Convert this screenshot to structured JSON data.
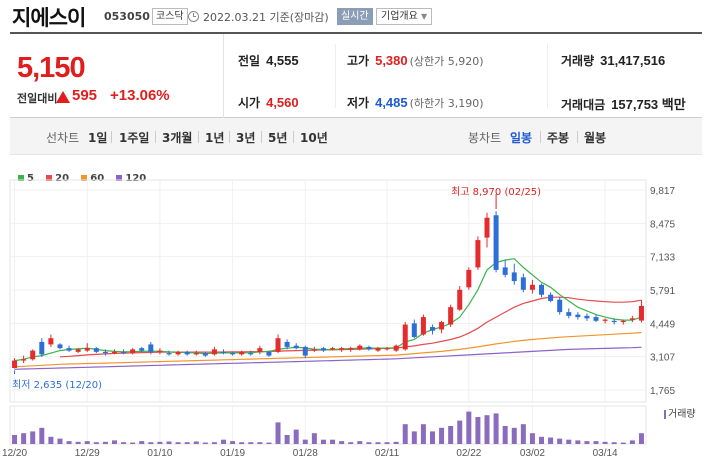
{
  "header": {
    "name": "지에스이",
    "code": "053050",
    "market": "코스닥",
    "date": "2022.03.21 기준(장마감)",
    "realtime": "실시간",
    "overview": "기업개요"
  },
  "quote": {
    "price": "5,150",
    "change_label": "전일대비",
    "change_amount": "595",
    "change_pct": "+13.06%",
    "prev_close_label": "전일",
    "prev_close": "4,555",
    "high_label": "고가",
    "high": "5,380",
    "upper_limit": "(상한가 5,920)",
    "volume_label": "거래량",
    "volume": "31,417,516",
    "open_label": "시가",
    "open": "4,560",
    "low_label": "저가",
    "low": "4,485",
    "lower_limit": "(하한가 3,190)",
    "amount_label": "거래대금",
    "amount": "157,753 백만"
  },
  "period_bar": {
    "line_label": "선차트",
    "line_items": [
      "1일",
      "1주일",
      "3개월",
      "1년",
      "3년",
      "5년",
      "10년"
    ],
    "candle_label": "봉차트",
    "candle_items": [
      "일봉",
      "주봉",
      "월봉"
    ],
    "active_candle": "일봉"
  },
  "legend": [
    {
      "label": "5",
      "color": "#3cb44b"
    },
    {
      "label": "20",
      "color": "#e64b4b"
    },
    {
      "label": "60",
      "color": "#f0962d"
    },
    {
      "label": "120",
      "color": "#8c64c8"
    }
  ],
  "volume_label": "거래량",
  "chart_data": {
    "type": "candlestick",
    "y_ticks": [
      "9,817",
      "8,475",
      "7,133",
      "5,791",
      "4,449",
      "3,107",
      "1,765"
    ],
    "y_values": [
      9817,
      8475,
      7133,
      5791,
      4449,
      3107,
      1765
    ],
    "x_labels": [
      "12/20",
      "12/29",
      "01/10",
      "01/19",
      "01/28",
      "02/11",
      "02/22",
      "03/02",
      "03/14"
    ],
    "max_label": "최고 8,970 (02/25)",
    "min_label": "최저 2,635 (12/20)",
    "candles": [
      {
        "o": 2650,
        "h": 3050,
        "l": 2635,
        "c": 2950
      },
      {
        "o": 2950,
        "h": 3150,
        "l": 2850,
        "c": 3000
      },
      {
        "o": 3000,
        "h": 3400,
        "l": 2950,
        "c": 3350
      },
      {
        "o": 3700,
        "h": 3850,
        "l": 3100,
        "c": 3200
      },
      {
        "o": 3600,
        "h": 4000,
        "l": 3500,
        "c": 3850
      },
      {
        "o": 3600,
        "h": 3650,
        "l": 3400,
        "c": 3450
      },
      {
        "o": 3450,
        "h": 3550,
        "l": 3300,
        "c": 3350
      },
      {
        "o": 3300,
        "h": 3450,
        "l": 3250,
        "c": 3400
      },
      {
        "o": 3350,
        "h": 3650,
        "l": 3300,
        "c": 3450
      },
      {
        "o": 3450,
        "h": 3500,
        "l": 3250,
        "c": 3300
      },
      {
        "o": 3300,
        "h": 3400,
        "l": 3150,
        "c": 3250
      },
      {
        "o": 3250,
        "h": 3400,
        "l": 3200,
        "c": 3300
      },
      {
        "o": 3300,
        "h": 3400,
        "l": 3200,
        "c": 3250
      },
      {
        "o": 3250,
        "h": 3450,
        "l": 3200,
        "c": 3400
      },
      {
        "o": 3450,
        "h": 3500,
        "l": 3300,
        "c": 3350
      },
      {
        "o": 3600,
        "h": 3700,
        "l": 3200,
        "c": 3300
      },
      {
        "o": 3300,
        "h": 3450,
        "l": 3200,
        "c": 3350
      },
      {
        "o": 3250,
        "h": 3350,
        "l": 3150,
        "c": 3200
      },
      {
        "o": 3200,
        "h": 3350,
        "l": 3150,
        "c": 3300
      },
      {
        "o": 3300,
        "h": 3350,
        "l": 3150,
        "c": 3200
      },
      {
        "o": 3200,
        "h": 3350,
        "l": 3150,
        "c": 3250
      },
      {
        "o": 3250,
        "h": 3300,
        "l": 3100,
        "c": 3150
      },
      {
        "o": 3200,
        "h": 3500,
        "l": 3150,
        "c": 3400
      },
      {
        "o": 3300,
        "h": 3400,
        "l": 3200,
        "c": 3250
      },
      {
        "o": 3250,
        "h": 3300,
        "l": 3150,
        "c": 3200
      },
      {
        "o": 3200,
        "h": 3350,
        "l": 3150,
        "c": 3300
      },
      {
        "o": 3250,
        "h": 3350,
        "l": 3150,
        "c": 3200
      },
      {
        "o": 3300,
        "h": 3550,
        "l": 3200,
        "c": 3450
      },
      {
        "o": 3300,
        "h": 3350,
        "l": 3100,
        "c": 3150
      },
      {
        "o": 3300,
        "h": 4000,
        "l": 3250,
        "c": 3850
      },
      {
        "o": 3700,
        "h": 3800,
        "l": 3400,
        "c": 3500
      },
      {
        "o": 3550,
        "h": 3650,
        "l": 3400,
        "c": 3450
      },
      {
        "o": 3500,
        "h": 3550,
        "l": 3050,
        "c": 3150
      },
      {
        "o": 3350,
        "h": 3500,
        "l": 3300,
        "c": 3400
      },
      {
        "o": 3450,
        "h": 3500,
        "l": 3300,
        "c": 3350
      },
      {
        "o": 3400,
        "h": 3500,
        "l": 3350,
        "c": 3450
      },
      {
        "o": 3400,
        "h": 3500,
        "l": 3300,
        "c": 3450
      },
      {
        "o": 3400,
        "h": 3500,
        "l": 3300,
        "c": 3450
      },
      {
        "o": 3400,
        "h": 3600,
        "l": 3350,
        "c": 3550
      },
      {
        "o": 3500,
        "h": 3550,
        "l": 3350,
        "c": 3400
      },
      {
        "o": 3350,
        "h": 3500,
        "l": 3300,
        "c": 3450
      },
      {
        "o": 3400,
        "h": 3500,
        "l": 3350,
        "c": 3450
      },
      {
        "o": 3350,
        "h": 3600,
        "l": 3300,
        "c": 3550
      },
      {
        "o": 3400,
        "h": 4500,
        "l": 3350,
        "c": 4400
      },
      {
        "o": 4450,
        "h": 4600,
        "l": 3850,
        "c": 3900
      },
      {
        "o": 4000,
        "h": 4800,
        "l": 3950,
        "c": 4700
      },
      {
        "o": 4300,
        "h": 4400,
        "l": 4000,
        "c": 4150
      },
      {
        "o": 4200,
        "h": 4550,
        "l": 4050,
        "c": 4500
      },
      {
        "o": 4400,
        "h": 5200,
        "l": 4300,
        "c": 5100
      },
      {
        "o": 5000,
        "h": 5950,
        "l": 4950,
        "c": 5800
      },
      {
        "o": 5900,
        "h": 6700,
        "l": 5800,
        "c": 6600
      },
      {
        "o": 6700,
        "h": 7950,
        "l": 6600,
        "c": 7800
      },
      {
        "o": 7900,
        "h": 8900,
        "l": 7500,
        "c": 8700
      },
      {
        "o": 8800,
        "h": 8970,
        "l": 6500,
        "c": 6600
      },
      {
        "o": 6700,
        "h": 7000,
        "l": 6300,
        "c": 6400
      },
      {
        "o": 6500,
        "h": 6850,
        "l": 6000,
        "c": 6150
      },
      {
        "o": 6300,
        "h": 6450,
        "l": 5700,
        "c": 5800
      },
      {
        "o": 5800,
        "h": 6200,
        "l": 5650,
        "c": 6000
      },
      {
        "o": 6000,
        "h": 6050,
        "l": 5500,
        "c": 5600
      },
      {
        "o": 5600,
        "h": 5700,
        "l": 5300,
        "c": 5350
      },
      {
        "o": 5400,
        "h": 5500,
        "l": 4800,
        "c": 4900
      },
      {
        "o": 4900,
        "h": 5050,
        "l": 4650,
        "c": 4750
      },
      {
        "o": 4800,
        "h": 4900,
        "l": 4600,
        "c": 4700
      },
      {
        "o": 4750,
        "h": 4850,
        "l": 4550,
        "c": 4650
      },
      {
        "o": 4700,
        "h": 4800,
        "l": 4500,
        "c": 4550
      },
      {
        "o": 4550,
        "h": 4650,
        "l": 4450,
        "c": 4600
      },
      {
        "o": 4550,
        "h": 4650,
        "l": 4400,
        "c": 4500
      },
      {
        "o": 4500,
        "h": 4600,
        "l": 4400,
        "c": 4550
      },
      {
        "o": 4600,
        "h": 4750,
        "l": 4500,
        "c": 4650
      },
      {
        "o": 4560,
        "h": 5380,
        "l": 4485,
        "c": 5150
      }
    ],
    "ma5": [
      2950,
      3000,
      3100,
      3150,
      3250,
      3350,
      3400,
      3420,
      3450,
      3400,
      3350,
      3320,
      3300,
      3310,
      3320,
      3330,
      3320,
      3300,
      3290,
      3270,
      3260,
      3230,
      3250,
      3260,
      3260,
      3260,
      3270,
      3300,
      3320,
      3400,
      3450,
      3480,
      3460,
      3400,
      3400,
      3390,
      3420,
      3430,
      3450,
      3450,
      3450,
      3450,
      3460,
      3700,
      3800,
      4050,
      4200,
      4300,
      4450,
      4700,
      5200,
      5800,
      6600,
      6900,
      7000,
      7050,
      6700,
      6400,
      6100,
      5900,
      5600,
      5350,
      5100,
      4950,
      4800,
      4700,
      4620,
      4580,
      4580,
      4700
    ],
    "ma20": [
      null,
      null,
      null,
      null,
      null,
      3100,
      3120,
      3150,
      3180,
      3200,
      3220,
      3240,
      3250,
      3260,
      3270,
      3280,
      3285,
      3290,
      3290,
      3290,
      3290,
      3290,
      3290,
      3295,
      3300,
      3300,
      3305,
      3310,
      3315,
      3330,
      3340,
      3350,
      3360,
      3370,
      3380,
      3385,
      3390,
      3400,
      3410,
      3420,
      3430,
      3440,
      3450,
      3500,
      3540,
      3600,
      3650,
      3720,
      3800,
      3900,
      4050,
      4250,
      4500,
      4700,
      4900,
      5100,
      5250,
      5350,
      5450,
      5500,
      5500,
      5480,
      5420,
      5380,
      5350,
      5320,
      5300,
      5300,
      5320,
      5380
    ],
    "ma60": [
      2700,
      2720,
      2740,
      2760,
      2780,
      2800,
      2810,
      2820,
      2830,
      2840,
      2850,
      2860,
      2870,
      2880,
      2890,
      2900,
      2910,
      2920,
      2930,
      2940,
      2950,
      2960,
      2970,
      2980,
      2990,
      3000,
      3010,
      3020,
      3030,
      3040,
      3050,
      3060,
      3070,
      3080,
      3090,
      3100,
      3110,
      3120,
      3130,
      3140,
      3150,
      3160,
      3170,
      3200,
      3230,
      3260,
      3290,
      3320,
      3360,
      3400,
      3450,
      3500,
      3560,
      3620,
      3670,
      3720,
      3760,
      3800,
      3830,
      3860,
      3890,
      3910,
      3930,
      3950,
      3970,
      3990,
      4010,
      4030,
      4050,
      4080
    ],
    "ma120": [
      2600,
      2610,
      2620,
      2630,
      2640,
      2650,
      2660,
      2670,
      2680,
      2690,
      2700,
      2710,
      2720,
      2730,
      2740,
      2750,
      2760,
      2770,
      2780,
      2790,
      2800,
      2810,
      2820,
      2830,
      2840,
      2850,
      2860,
      2870,
      2880,
      2890,
      2900,
      2910,
      2920,
      2930,
      2940,
      2950,
      2960,
      2970,
      2980,
      2990,
      3000,
      3010,
      3020,
      3040,
      3060,
      3080,
      3100,
      3120,
      3140,
      3160,
      3180,
      3200,
      3220,
      3240,
      3260,
      3280,
      3300,
      3320,
      3340,
      3360,
      3380,
      3400,
      3410,
      3420,
      3430,
      3440,
      3450,
      3460,
      3470,
      3490
    ],
    "volumes": [
      0.25,
      0.3,
      0.35,
      0.45,
      0.2,
      0.15,
      0.08,
      0.06,
      0.08,
      0.05,
      0.06,
      0.1,
      0.05,
      0.04,
      0.08,
      0.05,
      0.06,
      0.07,
      0.05,
      0.05,
      0.07,
      0.04,
      0.05,
      0.12,
      0.08,
      0.05,
      0.05,
      0.05,
      0.04,
      0.6,
      0.25,
      0.4,
      0.12,
      0.3,
      0.12,
      0.12,
      0.08,
      0.05,
      0.08,
      0.05,
      0.05,
      0.05,
      0.06,
      0.55,
      0.35,
      0.55,
      0.35,
      0.45,
      0.5,
      0.65,
      0.9,
      0.75,
      0.8,
      0.85,
      0.5,
      0.45,
      0.55,
      0.3,
      0.2,
      0.18,
      0.15,
      0.12,
      0.1,
      0.08,
      0.08,
      0.06,
      0.05,
      0.04,
      0.1,
      0.3
    ]
  }
}
